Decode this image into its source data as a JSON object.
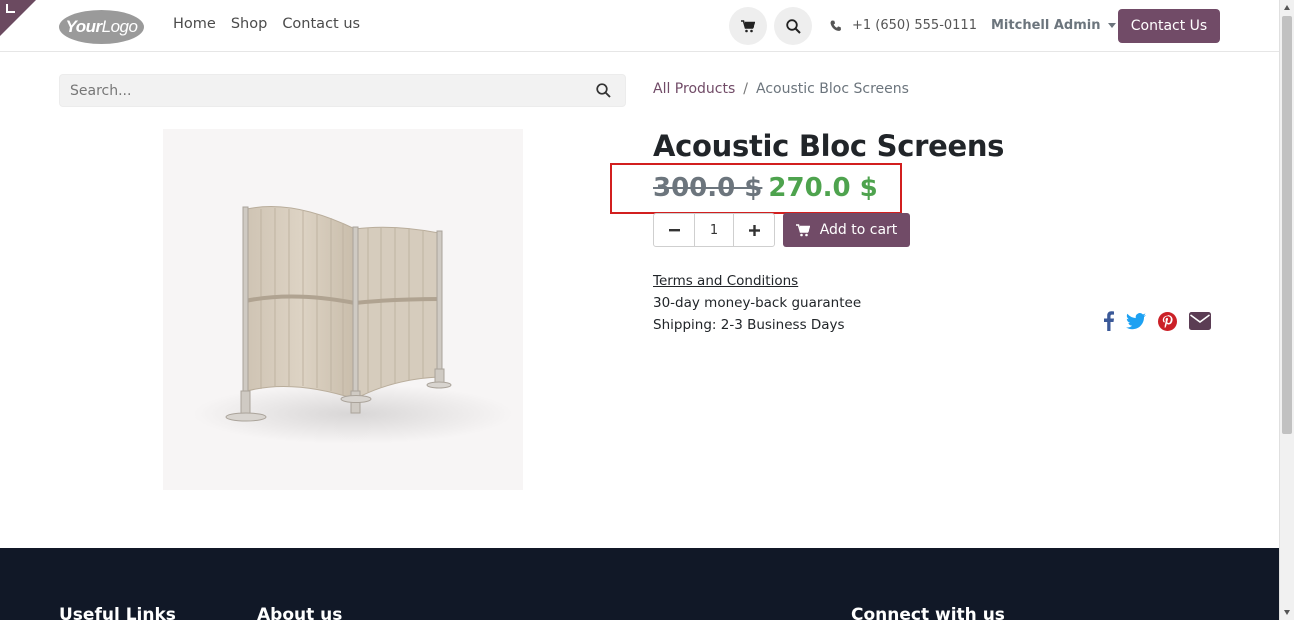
{
  "header": {
    "logo": {
      "bold": "Your",
      "light": "Logo"
    },
    "nav": [
      "Home",
      "Shop",
      "Contact us"
    ],
    "phone": "+1 (650) 555-0111",
    "user": "Mitchell Admin",
    "contact_button": "Contact Us"
  },
  "search": {
    "placeholder": "Search..."
  },
  "breadcrumb": {
    "parent": "All Products",
    "separator": "/",
    "current": "Acoustic Bloc Screens"
  },
  "product": {
    "name": "Acoustic Bloc Screens",
    "old_price": "300.0 $",
    "new_price": "270.0 $",
    "quantity": "1",
    "add_to_cart": "Add to cart",
    "terms_link": "Terms and Conditions",
    "guarantee": "30-day money-back guarantee",
    "shipping": "Shipping: 2-3 Business Days"
  },
  "social": [
    "facebook-icon",
    "twitter-icon",
    "pinterest-icon",
    "email-icon"
  ],
  "footer": {
    "col1": "Useful Links",
    "col2": "About us",
    "col3": "Connect with us"
  },
  "colors": {
    "brand": "#714b67",
    "sale": "#4ea34e",
    "highlight": "#d21f1f",
    "footer": "#111827"
  }
}
